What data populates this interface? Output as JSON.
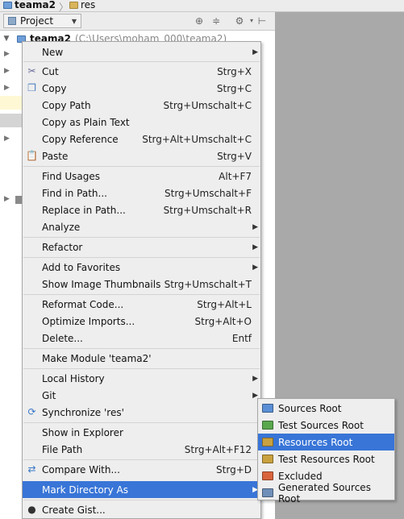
{
  "breadcrumb": {
    "project": "teama2",
    "folder": "res",
    "separator": "〉"
  },
  "panel": {
    "view_label": "Project",
    "root_name": "teama2",
    "root_path": "(C:\\Users\\moham_000\\teama2)"
  },
  "header_icons": [
    "target-icon",
    "collapse-icon",
    "settings-icon",
    "pin-icon"
  ],
  "menu": {
    "items": [
      {
        "label": "New",
        "shortcut": "",
        "submenu": true,
        "icon": ""
      },
      {
        "label": "Cut",
        "shortcut": "Strg+X",
        "submenu": false,
        "icon": "scissors-icon"
      },
      {
        "label": "Copy",
        "shortcut": "Strg+C",
        "submenu": false,
        "icon": "copy-icon"
      },
      {
        "label": "Copy Path",
        "shortcut": "Strg+Umschalt+C",
        "submenu": false,
        "icon": ""
      },
      {
        "label": "Copy as Plain Text",
        "shortcut": "",
        "submenu": false,
        "icon": ""
      },
      {
        "label": "Copy Reference",
        "shortcut": "Strg+Alt+Umschalt+C",
        "submenu": false,
        "icon": ""
      },
      {
        "label": "Paste",
        "shortcut": "Strg+V",
        "submenu": false,
        "icon": "paste-icon"
      },
      {
        "label": "Find Usages",
        "shortcut": "Alt+F7",
        "submenu": false,
        "icon": ""
      },
      {
        "label": "Find in Path...",
        "shortcut": "Strg+Umschalt+F",
        "submenu": false,
        "icon": ""
      },
      {
        "label": "Replace in Path...",
        "shortcut": "Strg+Umschalt+R",
        "submenu": false,
        "icon": ""
      },
      {
        "label": "Analyze",
        "shortcut": "",
        "submenu": true,
        "icon": ""
      },
      {
        "label": "Refactor",
        "shortcut": "",
        "submenu": true,
        "icon": ""
      },
      {
        "label": "Add to Favorites",
        "shortcut": "",
        "submenu": true,
        "icon": ""
      },
      {
        "label": "Show Image Thumbnails",
        "shortcut": "Strg+Umschalt+T",
        "submenu": false,
        "icon": ""
      },
      {
        "label": "Reformat Code...",
        "shortcut": "Strg+Alt+L",
        "submenu": false,
        "icon": ""
      },
      {
        "label": "Optimize Imports...",
        "shortcut": "Strg+Alt+O",
        "submenu": false,
        "icon": ""
      },
      {
        "label": "Delete...",
        "shortcut": "Entf",
        "submenu": false,
        "icon": ""
      },
      {
        "label": "Make Module 'teama2'",
        "shortcut": "",
        "submenu": false,
        "icon": ""
      },
      {
        "label": "Local History",
        "shortcut": "",
        "submenu": true,
        "icon": ""
      },
      {
        "label": "Git",
        "shortcut": "",
        "submenu": true,
        "icon": ""
      },
      {
        "label": "Synchronize 'res'",
        "shortcut": "",
        "submenu": false,
        "icon": "sync-icon"
      },
      {
        "label": "Show in Explorer",
        "shortcut": "",
        "submenu": false,
        "icon": ""
      },
      {
        "label": "File Path",
        "shortcut": "Strg+Alt+F12",
        "submenu": false,
        "icon": ""
      },
      {
        "label": "Compare With...",
        "shortcut": "Strg+D",
        "submenu": false,
        "icon": "compare-icon"
      },
      {
        "label": "Mark Directory As",
        "shortcut": "",
        "submenu": true,
        "icon": ""
      },
      {
        "label": "Create Gist...",
        "shortcut": "",
        "submenu": false,
        "icon": "github-icon"
      }
    ],
    "selected": "Mark Directory As"
  },
  "submenu": {
    "items": [
      {
        "label": "Sources Root",
        "color": "#5b8fd6"
      },
      {
        "label": "Test Sources Root",
        "color": "#5aa84e"
      },
      {
        "label": "Resources Root",
        "color": "#c9a13e"
      },
      {
        "label": "Test Resources Root",
        "color": "#c9a13e"
      },
      {
        "label": "Excluded",
        "color": "#d9643c"
      },
      {
        "label": "Generated Sources Root",
        "color": "#6f8fb8"
      }
    ],
    "selected": "Resources Root"
  },
  "colors": {
    "selection": "#3875d7",
    "menu_bg": "#eeeeee",
    "editor_bg": "#a9a9a9"
  }
}
